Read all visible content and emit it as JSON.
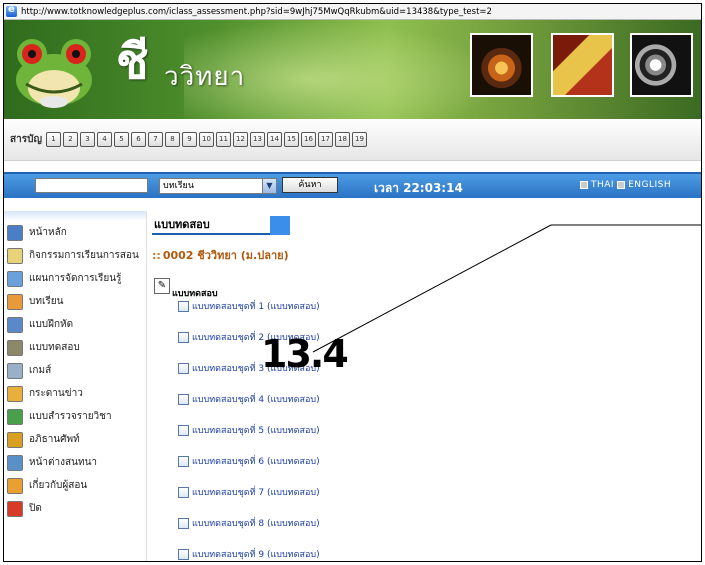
{
  "browser": {
    "url": "http://www.totknowledgeplus.com/iclass_assessment.php?sid=9wJhj75MwQqRkubm&uid=13438&type_test=2"
  },
  "header": {
    "logo_letter": "ชี",
    "logo_text": "ววิทยา",
    "toc_label": "สารบัญ",
    "toc_numbers": [
      "1",
      "2",
      "3",
      "4",
      "5",
      "6",
      "7",
      "8",
      "9",
      "10",
      "11",
      "12",
      "13",
      "14",
      "15",
      "16",
      "17",
      "18",
      "19"
    ]
  },
  "topbar": {
    "search_value": "",
    "select_value": "บทเรียน",
    "search_button": "ค้นหา",
    "time_text": "เวลา 22:03:14",
    "lang_thai": "THAI",
    "lang_english": "ENGLISH"
  },
  "sidebar": {
    "items": [
      {
        "label": "หน้าหลัก",
        "icon": "home-icon",
        "color": "#4a7fc8"
      },
      {
        "label": "กิจกรรมการเรียนการสอน",
        "icon": "activity-icon",
        "color": "#e8d27a"
      },
      {
        "label": "แผนการจัดการเรียนรู้",
        "icon": "plan-icon",
        "color": "#6aa0dc"
      },
      {
        "label": "บทเรียน",
        "icon": "lesson-icon",
        "color": "#e89a3a"
      },
      {
        "label": "แบบฝึกหัด",
        "icon": "exercise-icon",
        "color": "#5a88c8"
      },
      {
        "label": "แบบทดสอบ",
        "icon": "test-icon",
        "color": "#8a8a6a"
      },
      {
        "label": "เกมส์",
        "icon": "game-icon",
        "color": "#9ab0c8"
      },
      {
        "label": "กระดานข่าว",
        "icon": "board-icon",
        "color": "#e8b03a"
      },
      {
        "label": "แบบสำรวจรายวิชา",
        "icon": "survey-icon",
        "color": "#4aa04a"
      },
      {
        "label": "อภิธานศัพท์",
        "icon": "glossary-icon",
        "color": "#d8a020"
      },
      {
        "label": "หน้าต่างสนทนา",
        "icon": "chat-icon",
        "color": "#5a90c8"
      },
      {
        "label": "เกี่ยวกับผู้สอน",
        "icon": "teacher-icon",
        "color": "#e8a030"
      },
      {
        "label": "ปิด",
        "icon": "close-icon",
        "color": "#d83a2a"
      }
    ]
  },
  "main": {
    "tab_title": "แบบทดสอบ",
    "course_title": "0002  ชีววิทยา (ม.ปลาย)",
    "section_label": "แบบทดสอบ",
    "tests": [
      "แบบทดสอบชุดที่ 1 (แบบทดสอบ)",
      "แบบทดสอบชุดที่ 2 (แบบทดสอบ)",
      "แบบทดสอบชุดที่ 3 (แบบทดสอบ)",
      "แบบทดสอบชุดที่ 4 (แบบทดสอบ)",
      "แบบทดสอบชุดที่ 5 (แบบทดสอบ)",
      "แบบทดสอบชุดที่ 6 (แบบทดสอบ)",
      "แบบทดสอบชุดที่ 7 (แบบทดสอบ)",
      "แบบทดสอบชุดที่ 8 (แบบทดสอบ)",
      "แบบทดสอบชุดที่ 9 (แบบทดสอบ)"
    ]
  },
  "annotation": {
    "label": "13.4"
  }
}
